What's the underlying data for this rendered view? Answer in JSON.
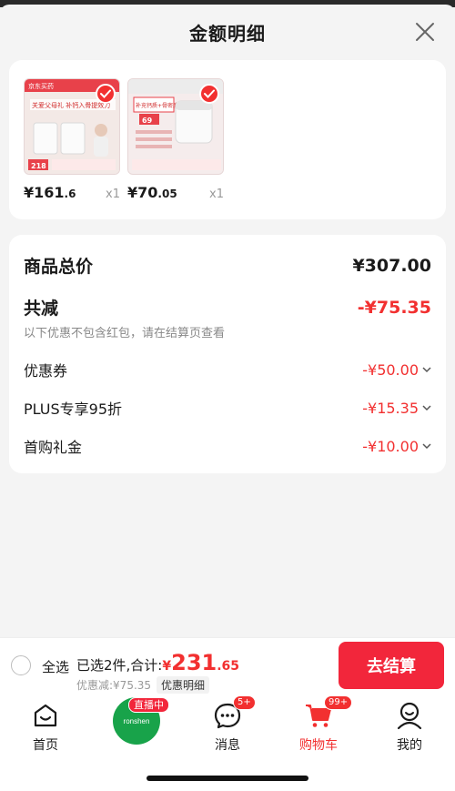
{
  "header": {
    "title": "金额明细"
  },
  "products": [
    {
      "price_int": "¥161",
      "price_dec": ".6",
      "qty": "x1",
      "store_tag": "京东买药",
      "promo_text": "关爱父母礼 补钙入骨提效力",
      "price_badge": "218"
    },
    {
      "price_int": "¥70",
      "price_dec": ".05",
      "qty": "x1",
      "promo_text": "补充钙质+骨密度",
      "price_badge": "69"
    }
  ],
  "summary": {
    "total_label": "商品总价",
    "total_value": "¥307.00",
    "reduce_label": "共减",
    "reduce_value": "-¥75.35",
    "note": "以下优惠不包含红包，请在结算页查看",
    "discounts": [
      {
        "label": "优惠券",
        "value": "-¥50.00"
      },
      {
        "label": "PLUS专享95折",
        "value": "-¥15.35"
      },
      {
        "label": "首购礼金",
        "value": "-¥10.00"
      }
    ]
  },
  "checkout": {
    "select_all": "全选",
    "selected_text": "已选2件,合计:",
    "total_currency": "¥",
    "total_int": "231",
    "total_dec": ".65",
    "discount_text": "优惠减:¥75.35",
    "detail_label": "优惠明细",
    "button_label": "去结算"
  },
  "tabbar": {
    "items": [
      {
        "label": "首页",
        "icon": "home-icon"
      },
      {
        "label": "",
        "icon": "live-avatar",
        "live_badge": "直播中",
        "brand": "ronshen"
      },
      {
        "label": "消息",
        "icon": "message-icon",
        "badge": "5+"
      },
      {
        "label": "购物车",
        "icon": "cart-icon",
        "badge": "99+"
      },
      {
        "label": "我的",
        "icon": "profile-icon"
      }
    ]
  },
  "colors": {
    "accent": "#f23030",
    "button": "#f2263b",
    "background": "#f4f4f4",
    "live": "#18a34a"
  }
}
